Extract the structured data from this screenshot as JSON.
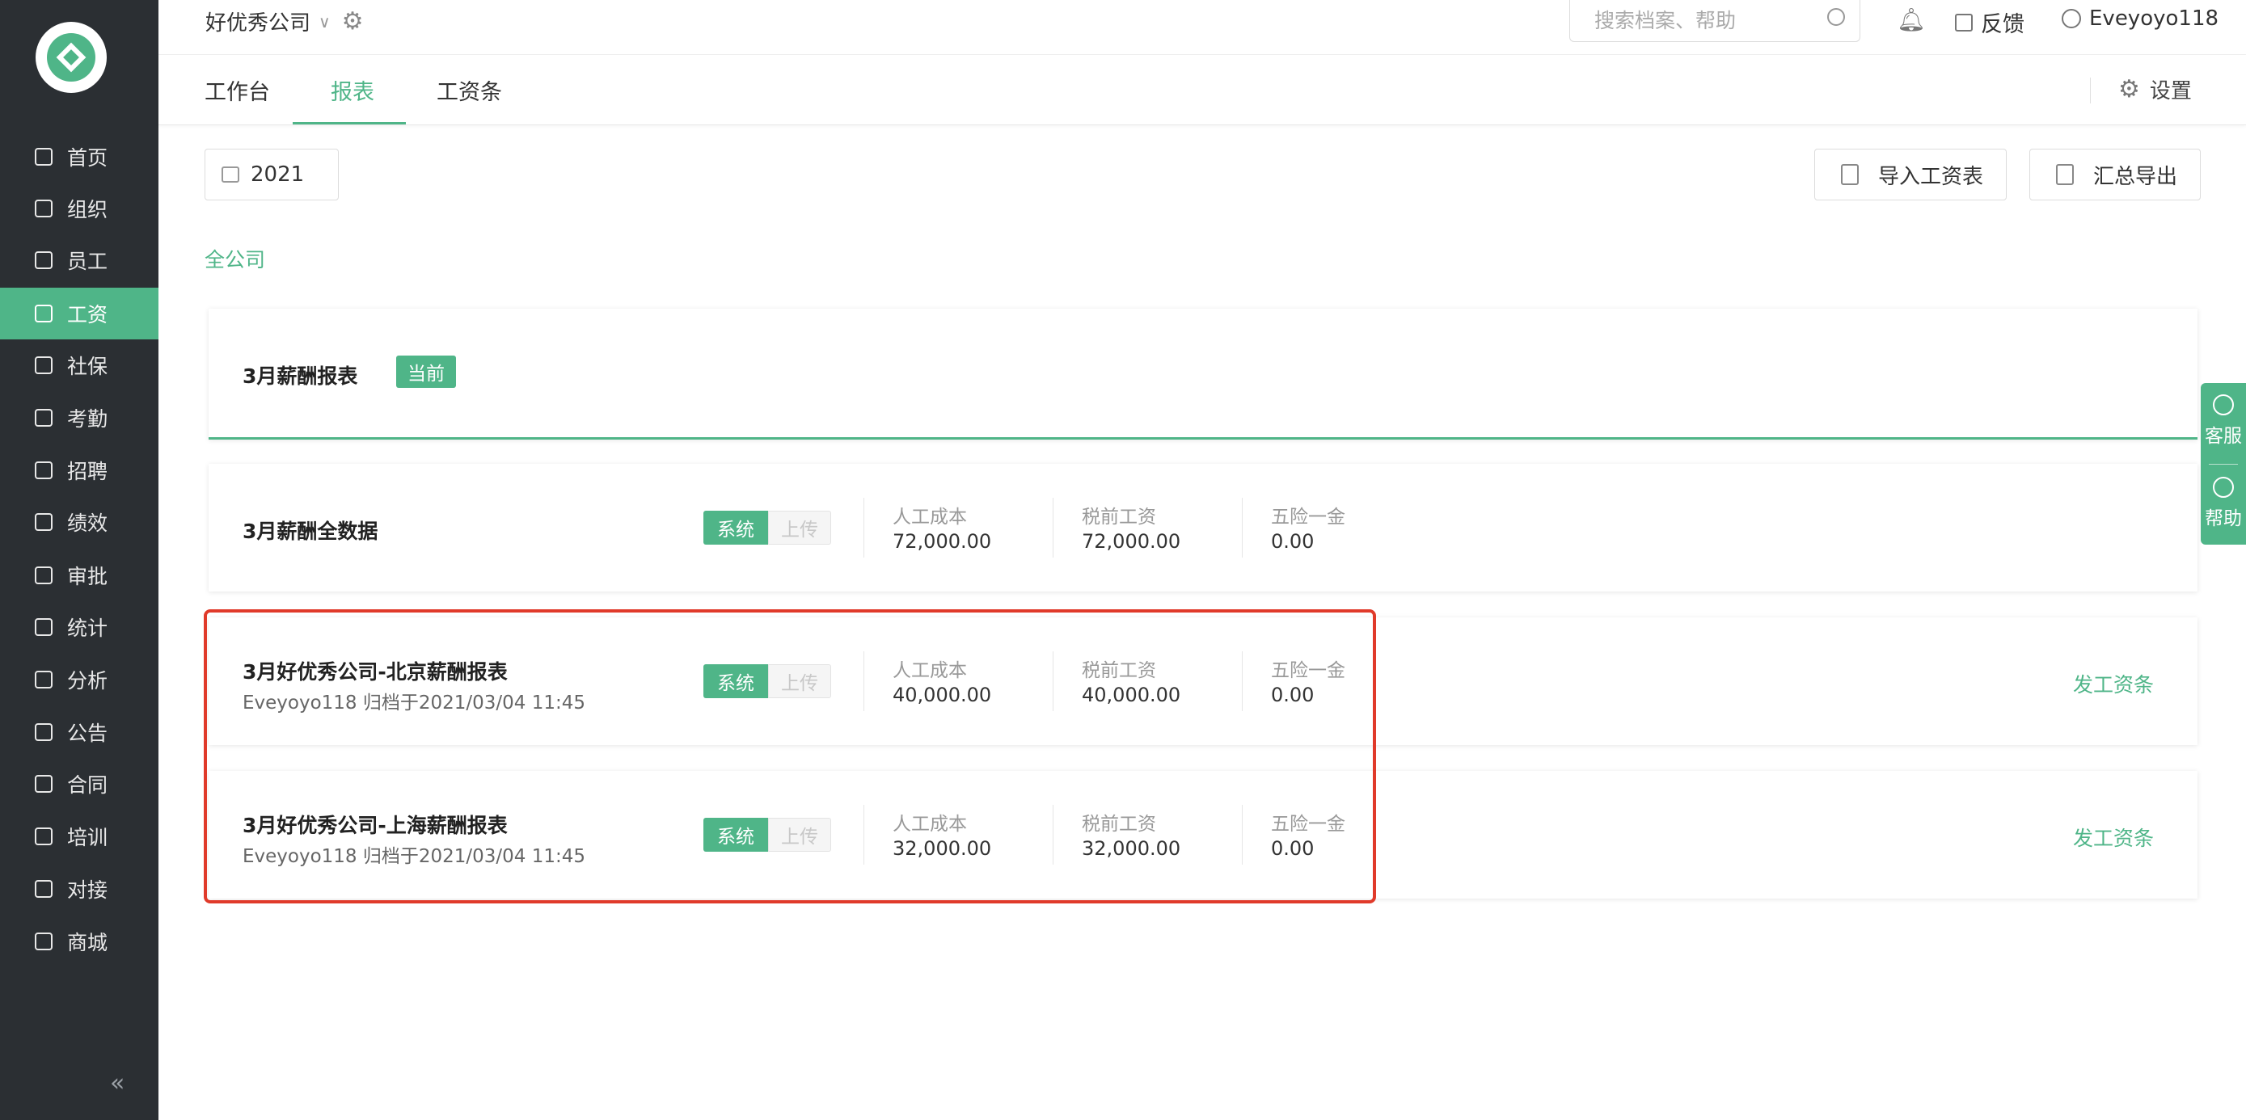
{
  "sidebar": {
    "items": [
      {
        "label": "首页"
      },
      {
        "label": "组织"
      },
      {
        "label": "员工"
      },
      {
        "label": "工资"
      },
      {
        "label": "社保"
      },
      {
        "label": "考勤"
      },
      {
        "label": "招聘"
      },
      {
        "label": "绩效"
      },
      {
        "label": "审批"
      },
      {
        "label": "统计"
      },
      {
        "label": "分析"
      },
      {
        "label": "公告"
      },
      {
        "label": "合同"
      },
      {
        "label": "培训"
      },
      {
        "label": "对接"
      },
      {
        "label": "商城"
      }
    ],
    "active_index": 3,
    "collapse_glyph": "«"
  },
  "header": {
    "company": "好优秀公司",
    "search_placeholder": "搜索档案、帮助",
    "feedback": "反馈",
    "user": "Eveyoyo118"
  },
  "tabs": {
    "items": [
      {
        "label": "工作台"
      },
      {
        "label": "报表"
      },
      {
        "label": "工资条"
      }
    ],
    "active_index": 1,
    "settings": "设置"
  },
  "toolbar": {
    "year": "2021",
    "import_label": "导入工资表",
    "export_label": "汇总导出"
  },
  "scope": "全公司",
  "current_card": {
    "title": "3月薪酬报表",
    "badge": "当前"
  },
  "labels": {
    "system": "系统",
    "upload": "上传",
    "cost": "人工成本",
    "pretax": "税前工资",
    "insurance": "五险一金"
  },
  "rows": [
    {
      "title": "3月薪酬全数据",
      "subtitle": "",
      "cost": "72,000.00",
      "pretax": "72,000.00",
      "insurance": "0.00",
      "action": ""
    },
    {
      "title": "3月好优秀公司-北京薪酬报表",
      "subtitle": "Eveyoyo118 归档于2021/03/04 11:45",
      "cost": "40,000.00",
      "pretax": "40,000.00",
      "insurance": "0.00",
      "action": "发工资条"
    },
    {
      "title": "3月好优秀公司-上海薪酬报表",
      "subtitle": "Eveyoyo118 归档于2021/03/04 11:45",
      "cost": "32,000.00",
      "pretax": "32,000.00",
      "insurance": "0.00",
      "action": "发工资条"
    }
  ],
  "float_panel": {
    "service": "客服",
    "help": "帮助"
  },
  "colors": {
    "accent": "#4fb588",
    "sidebar": "#2b2f33",
    "highlight": "#e03a2a"
  }
}
